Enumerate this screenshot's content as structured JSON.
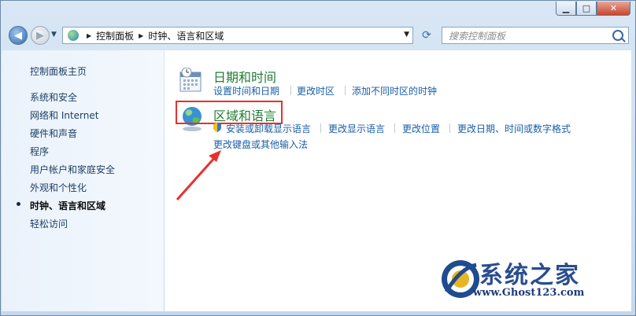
{
  "window": {
    "minimize": "▁",
    "maximize": "□",
    "close": "✕"
  },
  "address_bar": {
    "segments": [
      "控制面板",
      "时钟、语言和区域"
    ]
  },
  "search": {
    "placeholder": "搜索控制面板"
  },
  "sidebar": {
    "items": [
      {
        "label": "控制面板主页"
      },
      {
        "label": "系统和安全"
      },
      {
        "label": "网络和 Internet"
      },
      {
        "label": "硬件和声音"
      },
      {
        "label": "程序"
      },
      {
        "label": "用户帐户和家庭安全"
      },
      {
        "label": "外观和个性化"
      },
      {
        "label": "时钟、语言和区域",
        "active": true
      },
      {
        "label": "轻松访问"
      }
    ]
  },
  "categories": [
    {
      "title": "日期和时间",
      "icon": "calendar-clock-icon",
      "links": [
        "设置时间和日期",
        "更改时区",
        "添加不同时区的时钟"
      ]
    },
    {
      "title": "区域和语言",
      "icon": "globe-icon",
      "links": [
        "安装或卸载显示语言",
        "更改显示语言",
        "更改位置",
        "更改日期、时间或数字格式",
        "更改键盘或其他输入法"
      ]
    }
  ],
  "watermark": {
    "title": "系统之家",
    "url": "www.Ghost123.com"
  },
  "colors": {
    "link": "#1a5ea8",
    "category_title": "#1e7d32",
    "highlight": "#e8302e"
  }
}
